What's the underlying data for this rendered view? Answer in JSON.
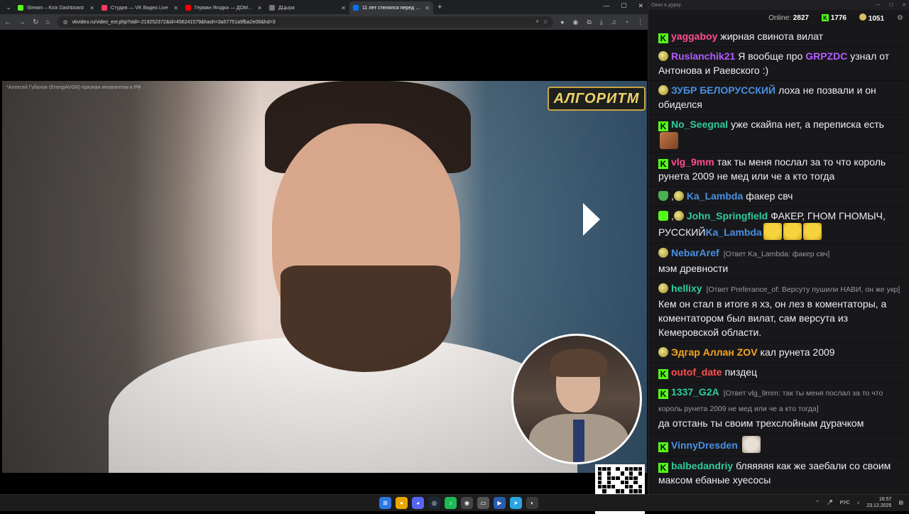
{
  "browser": {
    "tabs": [
      {
        "title": "Stream – Kick Dashboard",
        "color": "#53fc18",
        "active": false
      },
      {
        "title": "Студия — VK Видео Live",
        "color": "#ff3b5c",
        "active": false
      },
      {
        "title": "Герман Ягодка — ДОМ 2 и ав",
        "color": "#ff0000",
        "active": false
      },
      {
        "title": "ДЦыра",
        "color": "#777777",
        "active": false
      },
      {
        "title": "11 лет стелился перед Укр",
        "color": "#0077ff",
        "active": true
      }
    ],
    "url": "vkvideo.ru/video_ext.php?oid=-219252372&id=456241579&hash=3a57751a9fba2e06&hd=3"
  },
  "video": {
    "disclaimer": "*Алексей Губанов (EnergiAVGN) признан иноагентом в РФ",
    "logo": "АЛГОРИТМ"
  },
  "chat": {
    "title": "Окно в дурку",
    "online_label": "Online:",
    "online_count": "2827",
    "kick_count": "1776",
    "vk_count": "1051",
    "messages": [
      {
        "badges": [
          "kick"
        ],
        "user": "yaggaboy",
        "color": "#ff4f8b",
        "text": "жирная свинота вилат"
      },
      {
        "badges": [
          "veteran"
        ],
        "user": "Ruslanchik21",
        "color": "#b05cff",
        "text_before": "Я вообще про ",
        "mention": "GRPZDC",
        "mention_color": "#b05cff",
        "text": " узнал от Антонова и Раевского :)"
      },
      {
        "badges": [
          "veteran"
        ],
        "user": "ЗУБР БЕЛОРУССКИЙ",
        "color": "#4a90e2",
        "text": "лоха не позвали и он обиделся"
      },
      {
        "badges": [
          "kick"
        ],
        "user": "No_Seegnal",
        "color": "#2ecc9a",
        "text": "уже скайпа нет, а переписка есть",
        "emote": "face"
      },
      {
        "badges": [
          "kick"
        ],
        "user": "vlg_9mm",
        "color": "#ff4f8b",
        "text": "так ты меня послал за то что король рунета 2009 не мед или че а кто тогда"
      },
      {
        "badges": [
          "shield",
          "veteran"
        ],
        "user": "Ka_Lambda",
        "color": "#4a90e2",
        "text": "факер свч"
      },
      {
        "badges": [
          "mod",
          "veteran"
        ],
        "user": "John_Springfield",
        "color": "#2ecc9a",
        "text": "ФАКЕР, ГНОМ ГНОМЫЧ, РУССКИЙ",
        "mention": "Ka_Lambda",
        "mention_color": "#4a90e2",
        "emote": "laugh",
        "emote_count": 3
      },
      {
        "badges": [
          "veteran"
        ],
        "user": "NebarAref",
        "color": "#4a90e2",
        "reply": "[Ответ Ka_Lambda: факер свч]",
        "text": "мэм древности"
      },
      {
        "badges": [
          "veteran"
        ],
        "user": "hellixy",
        "color": "#2ecc9a",
        "reply": "[Ответ Preferance_of: Версуту пушили НАВИ, он же укр]",
        "text": "Кем он стал в итоге я хз, он лез в коментаторы, а коментатором был вилат, сам версута из Кемеровской области."
      },
      {
        "badges": [
          "veteran"
        ],
        "user": "Эдгар Аллан ZOV",
        "color": "#f5a623",
        "text": "кал рунета 2009"
      },
      {
        "badges": [
          "kick"
        ],
        "user": "outof_date",
        "color": "#ff4f4f",
        "text": "пиздец"
      },
      {
        "badges": [
          "kick"
        ],
        "user": "1337_G2A",
        "color": "#2ecc9a",
        "reply": "[Ответ vlg_9mm: так ты меня послал за то что король рунета 2009 не мед или че а кто тогда]",
        "text": "да отстань ты своим трехслойным дурачком"
      },
      {
        "badges": [
          "kick"
        ],
        "user": "VinnyDresden",
        "color": "#4a90e2",
        "text": "",
        "emote": "cat"
      },
      {
        "badges": [
          "kick"
        ],
        "user": "balbedandriy",
        "color": "#2ecc9a",
        "text": "бляяяяя как же заебали со своим максом ебаные хуесосы"
      }
    ]
  },
  "taskbar": {
    "lang": "РУС",
    "time": "16:57",
    "date": "23.12.2025"
  }
}
